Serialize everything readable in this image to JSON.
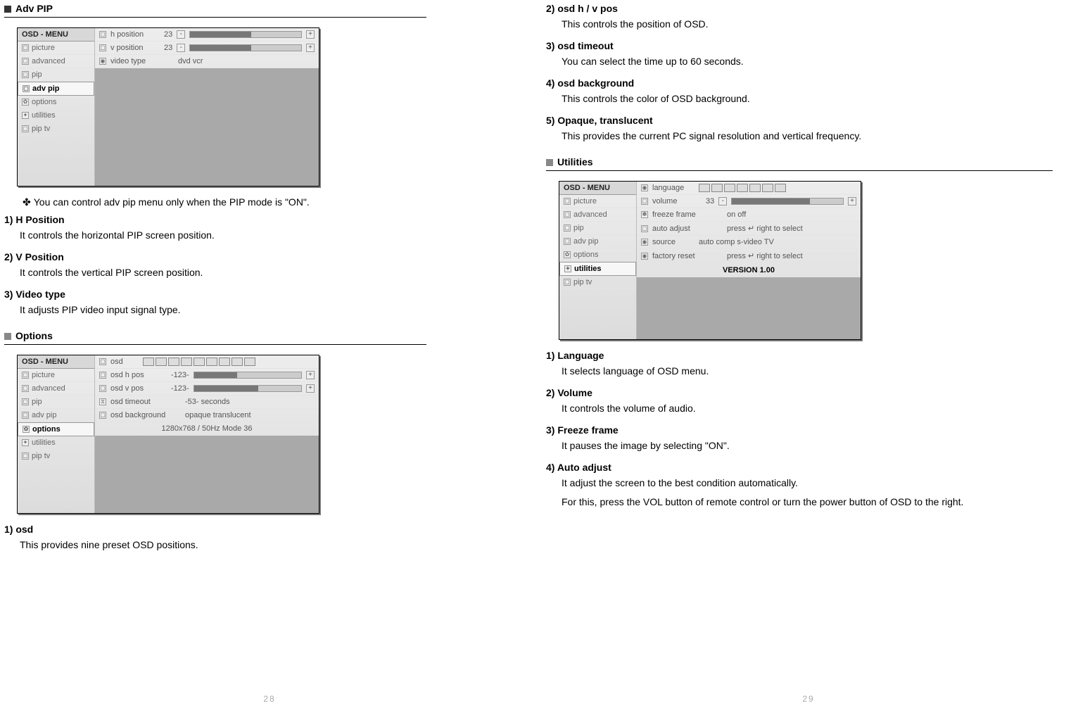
{
  "left": {
    "sec_advpip": "Adv PIP",
    "note": "You can control adv pip menu only when the PIP mode is \"ON\".",
    "h1": "1) H Position",
    "b1": "It controls the horizontal PIP screen position.",
    "h2": "2) V Position",
    "b2": "It controls the vertical PIP screen position.",
    "h3": "3) Video type",
    "b3": "It adjusts PIP video input signal type.",
    "sec_options": "Options",
    "oh1": "1) osd",
    "ob1": "This provides nine preset OSD positions.",
    "page": "28"
  },
  "right": {
    "rh2": "2) osd h / v pos",
    "rb2": "This controls the position of OSD.",
    "rh3": "3) osd timeout",
    "rb3": "You can select the time up to 60 seconds.",
    "rh4": "4) osd background",
    "rb4": "This controls the color of OSD background.",
    "rh5": "5) Opaque, translucent",
    "rb5": "This provides the current PC signal resolution and vertical frequency.",
    "sec_util": "Utilities",
    "uh1": "1) Language",
    "ub1": "It selects language of OSD menu.",
    "uh2": "2) Volume",
    "ub2": "It controls the volume of audio.",
    "uh3": "3) Freeze frame",
    "ub3": "It pauses the image by selecting \"ON\".",
    "uh4": "4) Auto adjust",
    "ub4a": "It adjust the screen to the best condition automatically.",
    "ub4b": "For this, press the VOL button of remote control or turn the power button of OSD to the right.",
    "page": "29"
  },
  "osd_common": {
    "title": "OSD - MENU",
    "menu": {
      "picture": "picture",
      "advanced": "advanced",
      "pip": "pip",
      "advpip": "adv pip",
      "options": "options",
      "utilities": "utilities",
      "pip_tv": "pip tv"
    }
  },
  "osd1": {
    "hpos_label": "h position",
    "hpos_val": "23",
    "vpos_label": "v position",
    "vpos_val": "23",
    "vtype_label": "video type",
    "vtype_opts": "dvd       vcr"
  },
  "osd2": {
    "osd_label": "osd",
    "hpos_label": "osd h pos",
    "hpos_val": "-123-",
    "vpos_label": "osd v pos",
    "vpos_val": "-123-",
    "timeout_label": "osd timeout",
    "timeout_val": "-53- seconds",
    "bg_label": "osd background",
    "bg_opts": "opaque   translucent",
    "mode": "1280x768  /  50Hz        Mode 36"
  },
  "osd3": {
    "lang_label": "language",
    "vol_label": "volume",
    "vol_val": "33",
    "freeze_label": "freeze frame",
    "freeze_opts": "on        off",
    "auto_label": "auto adjust",
    "auto_hint": "press ↵ right to select",
    "src_label": "source",
    "src_opts": "auto  comp  s-video  TV",
    "factory_label": "factory reset",
    "factory_hint": "press ↵ right to select",
    "version": "VERSION 1.00"
  }
}
